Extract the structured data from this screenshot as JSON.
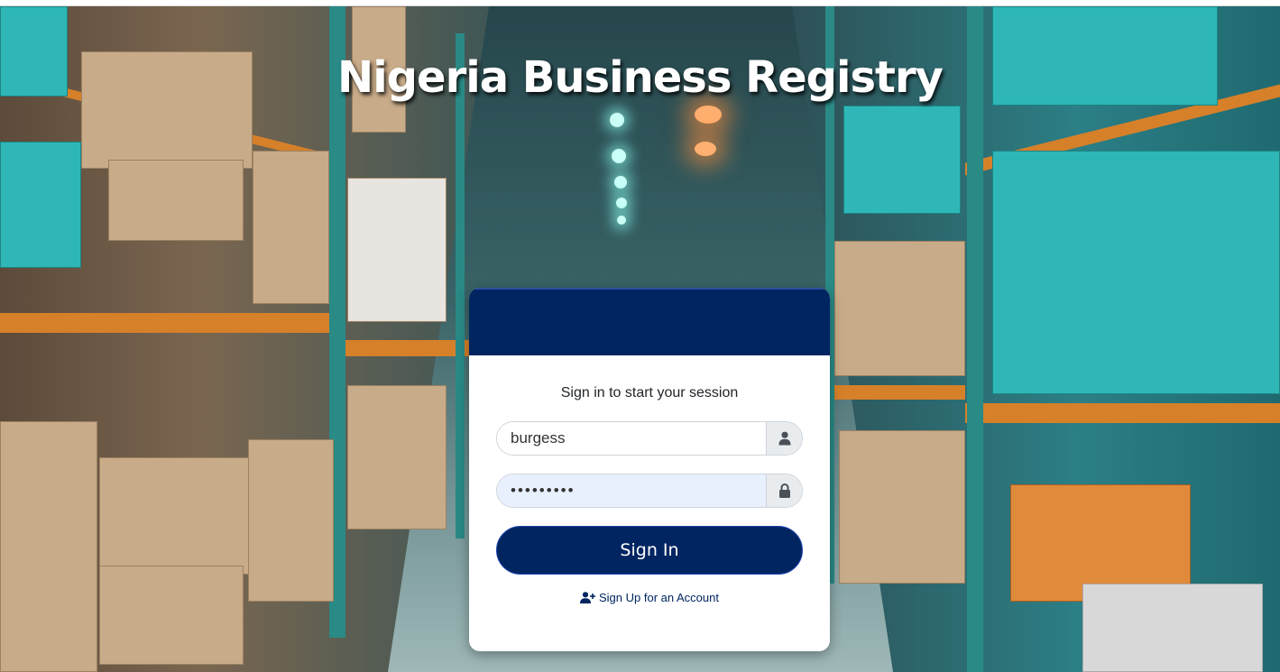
{
  "page": {
    "title": "Nigeria Business Registry"
  },
  "login": {
    "message": "Sign in to start your session",
    "username_value": "burgess",
    "password_value": "•••••••••",
    "username_icon": "user-icon",
    "password_icon": "lock-icon",
    "signin_label": "Sign In",
    "signup_label": "Sign Up for an Account",
    "signup_icon": "user-plus-icon"
  },
  "colors": {
    "brand": "#012561",
    "background_theme": "#2a7f85"
  }
}
